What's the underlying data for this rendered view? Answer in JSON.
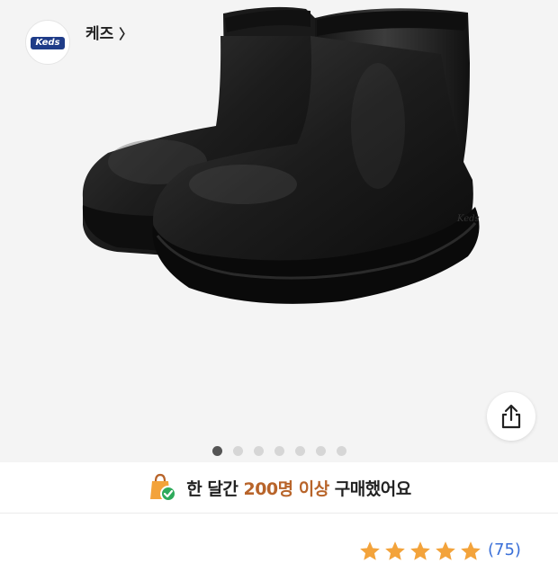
{
  "gallery": {
    "image_alt": "Black Keds rubber ankle boots",
    "dot_count": 7,
    "active_index": 0
  },
  "share": {
    "icon": "share-icon"
  },
  "promo": {
    "prefix": "한 달간 ",
    "highlight": "200명 이상",
    "suffix": " 구매했어요",
    "icon": "shopping-bag-check-icon"
  },
  "brand": {
    "logo_text": "Keds",
    "name": "케즈",
    "chevron": "〉"
  },
  "rating": {
    "stars": 5,
    "count_text": "(75)"
  },
  "colors": {
    "accent": "#b8642a",
    "link": "#3a6fd8",
    "star": "#f3a33b"
  }
}
